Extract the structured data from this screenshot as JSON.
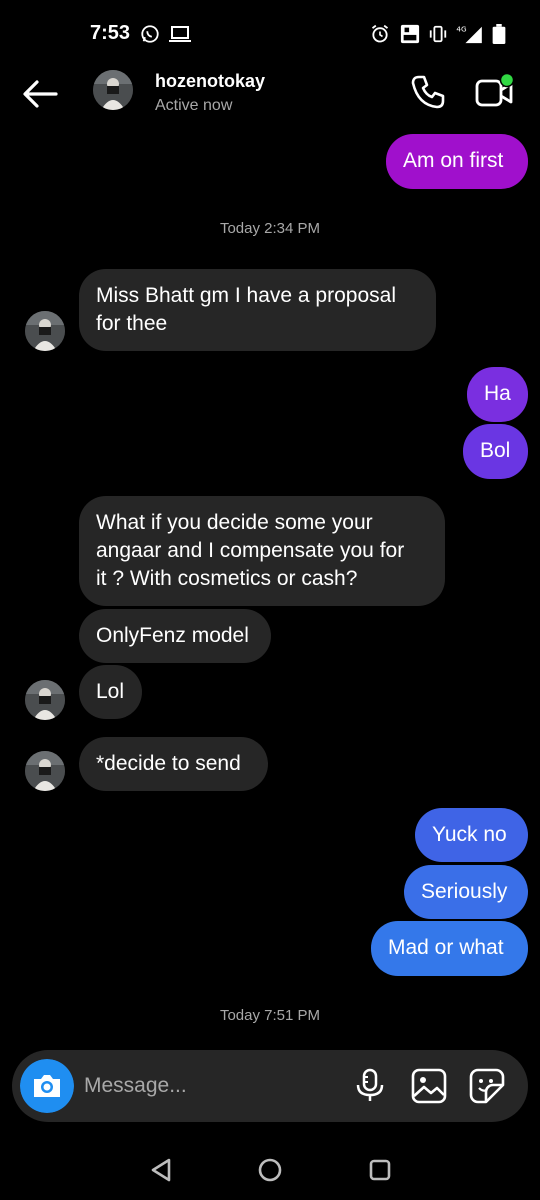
{
  "status_bar": {
    "time": "7:53",
    "icons": [
      "whatsapp-icon",
      "laptop-icon",
      "alarm-icon",
      "volte-icon",
      "vibrate-icon",
      "signal-4g-icon",
      "battery-icon"
    ]
  },
  "header": {
    "contact_name": "hozenotokay",
    "contact_status": "Active now",
    "icons": [
      "back-arrow-icon",
      "phone-icon",
      "video-camera-icon"
    ],
    "online_dot_color": "#31d843"
  },
  "messages": {
    "m1": "Am on first",
    "ts1": "Today 2:34 PM",
    "m2_line1": "Miss Bhatt gm I have a proposal",
    "m2_line2": "for thee",
    "m3": "Ha",
    "m4": "Bol",
    "m5_line1": "What if you decide some your",
    "m5_line2": "angaar and I compensate you for",
    "m5_line3": "it ? With cosmetics or cash?",
    "m6": "OnlyFenz model",
    "m7": "Lol",
    "m8": "*decide to send",
    "m9": "Yuck no",
    "m10": "Seriously",
    "m11": "Mad or what",
    "ts2": "Today 7:51 PM"
  },
  "composer": {
    "placeholder": "Message...",
    "icons": [
      "camera-icon",
      "microphone-icon",
      "gallery-icon",
      "sticker-icon"
    ]
  },
  "nav": {
    "icons": [
      "back-triangle-icon",
      "home-circle-icon",
      "recents-square-icon"
    ]
  },
  "colors": {
    "background": "#000000",
    "incoming_bubble": "#262626",
    "outgoing_magenta": "#a010cc",
    "outgoing_purple": "#7a2fe0",
    "outgoing_blue": "#3a6fe8",
    "camera_button": "#1f8ef1",
    "secondary_text": "#a8a8a8"
  }
}
